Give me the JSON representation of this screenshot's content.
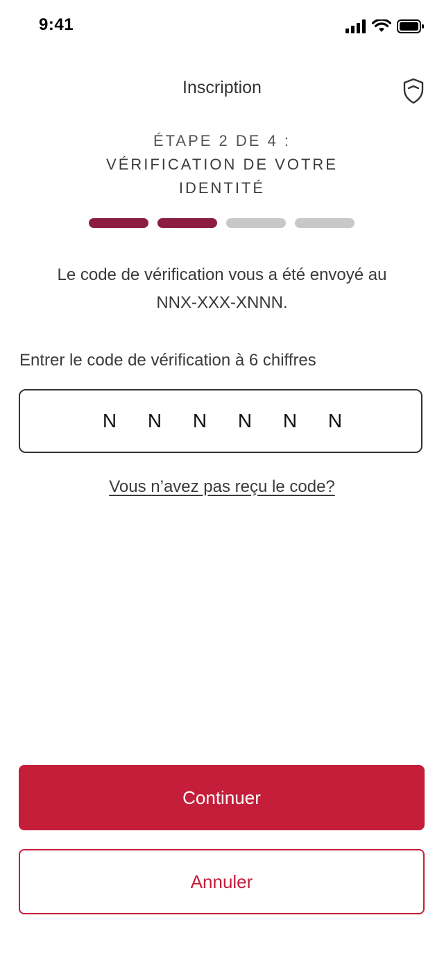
{
  "status_bar": {
    "time": "9:41",
    "icons": [
      "cellular-signal-icon",
      "wifi-icon",
      "battery-icon"
    ]
  },
  "header": {
    "title": "Inscription",
    "security_icon": "shield-icon"
  },
  "step": {
    "line1": "ÉTAPE 2 DE 4 :",
    "line2": "VÉRIFICATION DE VOTRE",
    "line3": "IDENTITÉ",
    "current": 2,
    "total": 4
  },
  "message": {
    "line1": "Le code de vérification vous a été envoyé au",
    "line2": "NNX-XXX-XNNN."
  },
  "code_field": {
    "label": "Entrer le code de vérification à 6 chiffres",
    "digits": [
      "N",
      "N",
      "N",
      "N",
      "N",
      "N"
    ]
  },
  "resend_link": "Vous n’avez pas reçu le code?",
  "buttons": {
    "continue": "Continuer",
    "cancel": "Annuler"
  },
  "colors": {
    "accent": "#c41e3a",
    "progress_active": "#8c1c44",
    "progress_inactive": "#c8c8c8"
  }
}
